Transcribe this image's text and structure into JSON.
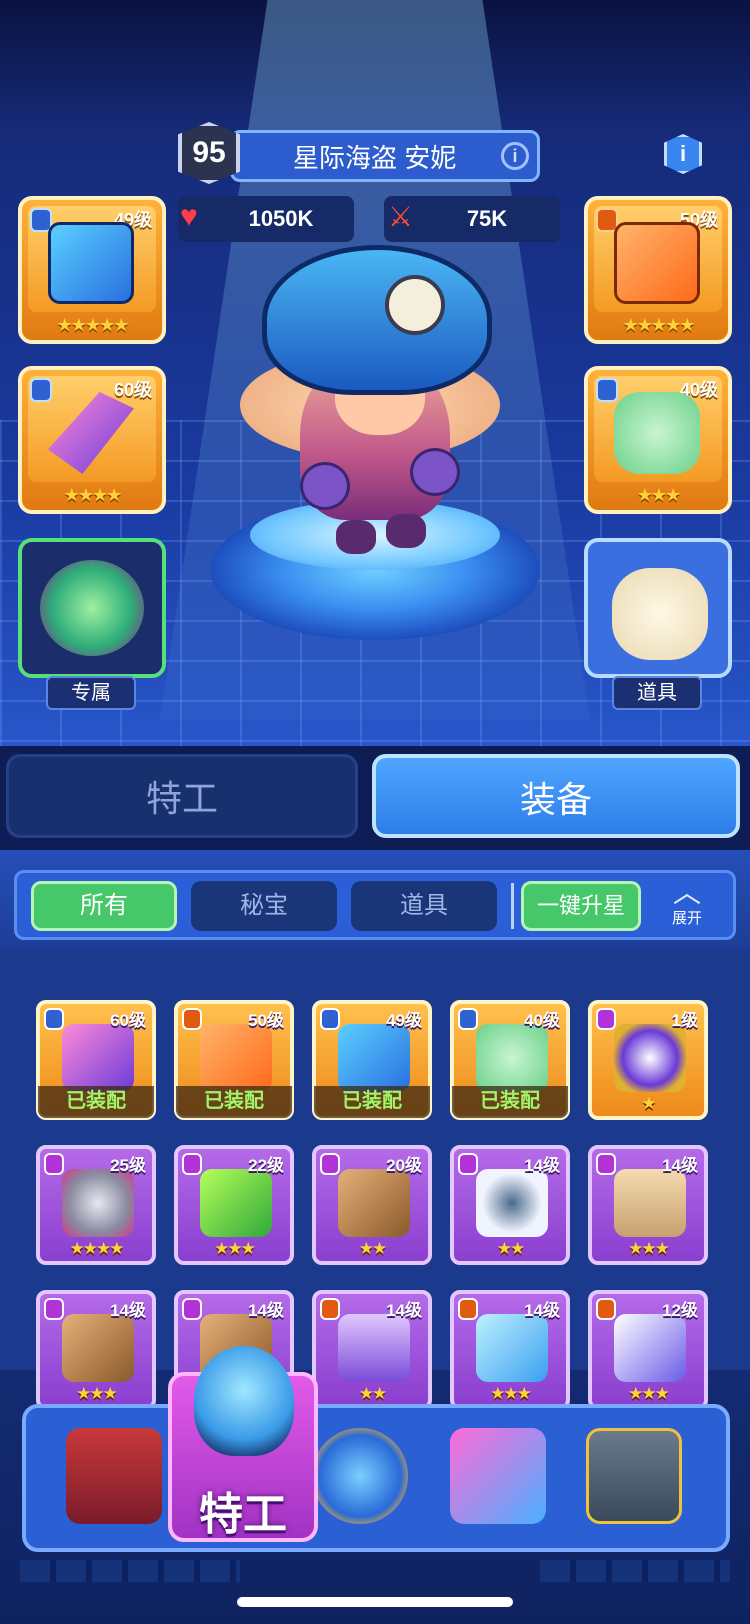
{
  "hero": {
    "level": "95",
    "name": "星际海盗 安妮",
    "hp": "1050K",
    "attack": "75K"
  },
  "slots": {
    "left": [
      {
        "level": "49级",
        "stars": "★★★★★",
        "icon": "cube-book-icon"
      },
      {
        "level": "60级",
        "stars": "★★★★",
        "icon": "crystal-spear-icon"
      }
    ],
    "right": [
      {
        "level": "50级",
        "stars": "★★★★★",
        "icon": "treasure-map-icon"
      },
      {
        "level": "40级",
        "stars": "★★★",
        "icon": "emerald-gem-icon"
      }
    ],
    "exclusive_label": "专属",
    "item_label": "道具"
  },
  "tabs": {
    "agent": "特工",
    "equipment": "装备"
  },
  "filters": {
    "all": "所有",
    "treasure": "秘宝",
    "items": "道具",
    "upgrade_all": "一键升星",
    "expand": "展开"
  },
  "inventory": {
    "equipped_label": "已装配",
    "items": [
      {
        "level": "60级",
        "stars": "",
        "color": "gold",
        "badge": "blue",
        "equipped": true,
        "icon": "crystal-spear-icon"
      },
      {
        "level": "50级",
        "stars": "",
        "color": "gold",
        "badge": "fire",
        "equipped": true,
        "icon": "treasure-map-icon"
      },
      {
        "level": "49级",
        "stars": "",
        "color": "gold",
        "badge": "blue",
        "equipped": true,
        "icon": "cube-book-icon"
      },
      {
        "level": "40级",
        "stars": "",
        "color": "gold",
        "badge": "blue",
        "equipped": true,
        "icon": "emerald-gem-icon"
      },
      {
        "level": "1级",
        "stars": "★",
        "color": "gold",
        "badge": "purp",
        "equipped": false,
        "icon": "pocket-watch-icon"
      },
      {
        "level": "25级",
        "stars": "★★★★",
        "color": "purple",
        "badge": "purp",
        "equipped": false,
        "icon": "gear-device-icon"
      },
      {
        "level": "22级",
        "stars": "★★★",
        "color": "purple",
        "badge": "purp",
        "equipped": false,
        "icon": "slime-vial-icon"
      },
      {
        "level": "20级",
        "stars": "★★",
        "color": "purple",
        "badge": "purp",
        "equipped": false,
        "icon": "scroll-icon"
      },
      {
        "level": "14级",
        "stars": "★★",
        "color": "purple",
        "badge": "purp",
        "equipped": false,
        "icon": "fur-ring-icon"
      },
      {
        "level": "14级",
        "stars": "★★★",
        "color": "purple",
        "badge": "purp",
        "equipped": false,
        "icon": "cipher-sheet-icon"
      },
      {
        "level": "14级",
        "stars": "★★★",
        "color": "purple",
        "badge": "purp",
        "equipped": false,
        "icon": "scroll-icon"
      },
      {
        "level": "14级",
        "stars": "★★★",
        "color": "purple",
        "badge": "purp",
        "equipped": false,
        "icon": "scroll-icon"
      },
      {
        "level": "14级",
        "stars": "★★",
        "color": "purple",
        "badge": "fire",
        "equipped": false,
        "icon": "potion-jar-icon"
      },
      {
        "level": "14级",
        "stars": "★★★",
        "color": "purple",
        "badge": "fire",
        "equipped": false,
        "icon": "ice-crystal-icon"
      },
      {
        "level": "12级",
        "stars": "★★★",
        "color": "purple",
        "badge": "fire",
        "equipped": false,
        "icon": "shard-blade-icon"
      }
    ]
  },
  "nav": {
    "active_label": "特工"
  },
  "colors": {
    "gold": "#ed8a1a",
    "purple": "#8a3fcf",
    "accent": "#2d7de8",
    "green": "#46c86a"
  }
}
